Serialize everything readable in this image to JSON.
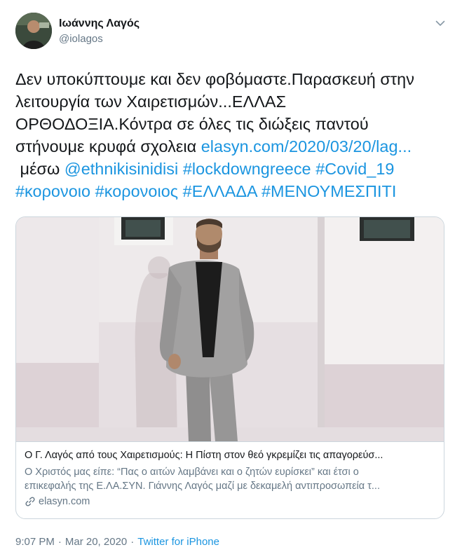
{
  "author": {
    "display_name": "Ιωάννης Λαγός",
    "handle": "@iolagos"
  },
  "tweet": {
    "text_line1": "Δεν υποκύπτουμε και δεν φοβόμαστε.Παρασκευή στην",
    "text_line2": "λειτουργία των Χαιρετισμών...ΕΛΛΑΣ",
    "text_line3": "ΟΡΘΟΔΟΞΙΑ.Κόντρα σε όλες τις διώξεις παντού",
    "text_line4_prefix": "στήνουμε κρυφά σχολεια ",
    "link_url": "elasyn.com/2020/03/20/lag...",
    "via_label": " μέσω ",
    "mention": "@ethnikisinidisi",
    "hashtags_line1": [
      "#lockdowngreece",
      "#Covid_19"
    ],
    "hashtags_line2": [
      "#κορονοιο",
      "#κορονοιος",
      "#ΕΛΛΑΔΑ",
      "#ΜΕΝΟΥΜΕΣΠΙΤΙ"
    ]
  },
  "card": {
    "title": "Ο Γ. Λαγός από τους Χαιρετισμούς: Η Πίστη στον θεό γκρεμίζει τις απαγορεύσ...",
    "description_line1": "Ο Χριστός μας είπε: “Πας ο αιτών λαμβάνει και ο ζητών ευρίσκει” και έτσι ο",
    "description_line2": "επικεφαλής της Ε.ΛΑ.ΣΥΝ. Γιάννης Λαγός μαζί με δεκαμελή αντιπροσωπεία τ...",
    "domain": "elasyn.com",
    "icon": "link-icon"
  },
  "footer": {
    "time": "9:07 PM",
    "separator": "·",
    "date": "Mar 20, 2020",
    "source": "Twitter for iPhone"
  },
  "colors": {
    "link": "#1b95e0",
    "secondary_text": "#657786",
    "primary_text": "#14171a",
    "border": "#ccd6dd"
  },
  "icons": [
    "avatar",
    "chevron-down-icon",
    "link-icon"
  ]
}
